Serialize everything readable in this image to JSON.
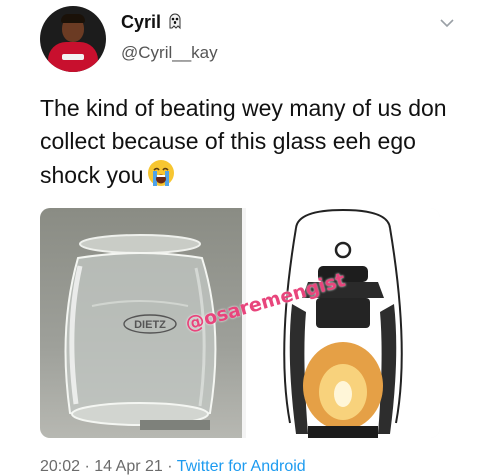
{
  "author": {
    "display_name": "Cyril",
    "handle": "@Cyril__kay"
  },
  "tweet": {
    "text": "The kind of beating wey many of us don collect because of this glass eeh ego shock you"
  },
  "media": {
    "glass_label": "DIETZ",
    "watermark": "@osaremengist"
  },
  "meta": {
    "time": "20:02",
    "separator1": "·",
    "date": "14 Apr 21",
    "separator2": "·",
    "source": "Twitter for Android"
  },
  "icons": {
    "name_emoji": "ghost-emoji-icon",
    "text_emoji": "loudly-crying-face-icon",
    "menu": "chevron-down-icon"
  },
  "colors": {
    "link": "#1d9bf0",
    "watermark": "#e8457c",
    "text": "#111111"
  }
}
